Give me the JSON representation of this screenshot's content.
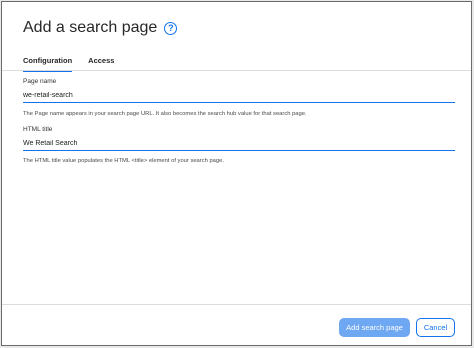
{
  "dialog": {
    "title": "Add a search page",
    "help_icon": "?",
    "tabs": [
      {
        "label": "Configuration",
        "active": true
      },
      {
        "label": "Access",
        "active": false
      }
    ],
    "page_name": {
      "label": "Page name",
      "value": "we-retail-search",
      "helper": "The Page name appears in your search page URL. It also becomes the search hub value for that search page."
    },
    "html_title": {
      "label": "HTML title",
      "value": "We Retail Search",
      "helper": "The HTML title value populates the HTML <title> element of your search page."
    },
    "buttons": {
      "add": "Add search page",
      "cancel": "Cancel"
    }
  },
  "colors": {
    "accent": "#1372ec",
    "primary_button": "#6ea7f2"
  }
}
